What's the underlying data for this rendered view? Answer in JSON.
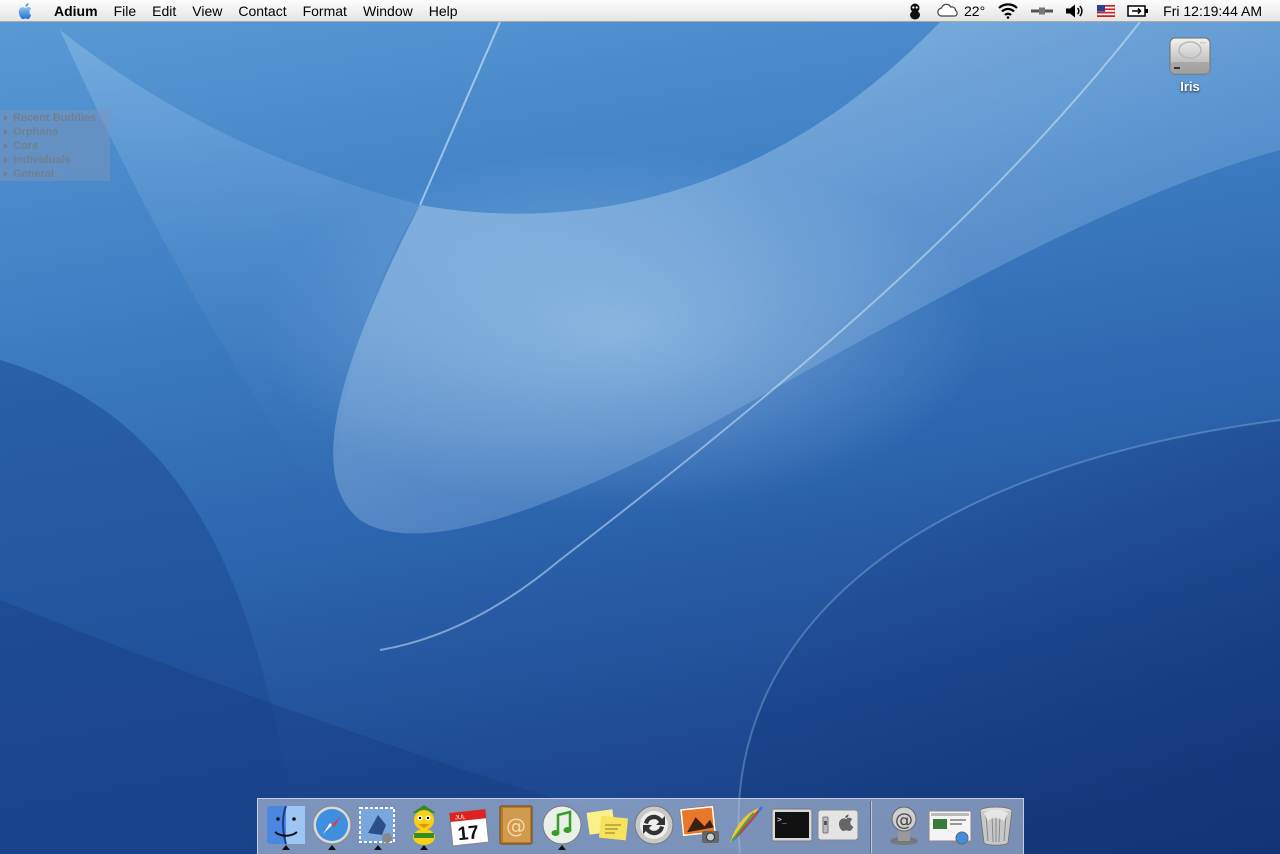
{
  "menubar": {
    "app_name": "Adium",
    "menus": [
      "File",
      "Edit",
      "View",
      "Contact",
      "Format",
      "Window",
      "Help"
    ],
    "weather_temp": "22°",
    "clock": "Fri 12:19:44 AM",
    "extras_icons": [
      "adium-status-icon",
      "weather-icon",
      "wifi-icon",
      "displays-icon",
      "volume-icon",
      "us-flag-icon",
      "battery-icon"
    ]
  },
  "buddy_list": {
    "groups": [
      "Recent Buddies",
      "Orphans",
      "Core",
      "Individuals",
      "General"
    ]
  },
  "desktop": {
    "drive_label": "Iris"
  },
  "dock": {
    "apps": [
      {
        "icon": "finder-icon",
        "running": true
      },
      {
        "icon": "safari-icon",
        "running": true
      },
      {
        "icon": "mail-icon",
        "running": true
      },
      {
        "icon": "adium-duck-icon",
        "running": true
      },
      {
        "icon": "ical-icon",
        "running": false,
        "date_day": "17",
        "date_month": "JUL"
      },
      {
        "icon": "address-book-icon",
        "running": false
      },
      {
        "icon": "itunes-icon",
        "running": true
      },
      {
        "icon": "stickies-icon",
        "running": false
      },
      {
        "icon": "isync-icon",
        "running": false
      },
      {
        "icon": "iphoto-icon",
        "running": false
      },
      {
        "icon": "quill-app-icon",
        "running": false
      },
      {
        "icon": "terminal-icon",
        "running": false
      },
      {
        "icon": "system-preferences-icon",
        "running": false
      }
    ],
    "docs": [
      {
        "icon": "mail-stack-icon"
      },
      {
        "icon": "screenshot-doc-icon"
      },
      {
        "icon": "trash-icon"
      }
    ]
  },
  "colors": {
    "wallpaper_top": "#5b9bd5",
    "wallpaper_bottom": "#163b7d",
    "menubar_bg": "#ececec"
  }
}
